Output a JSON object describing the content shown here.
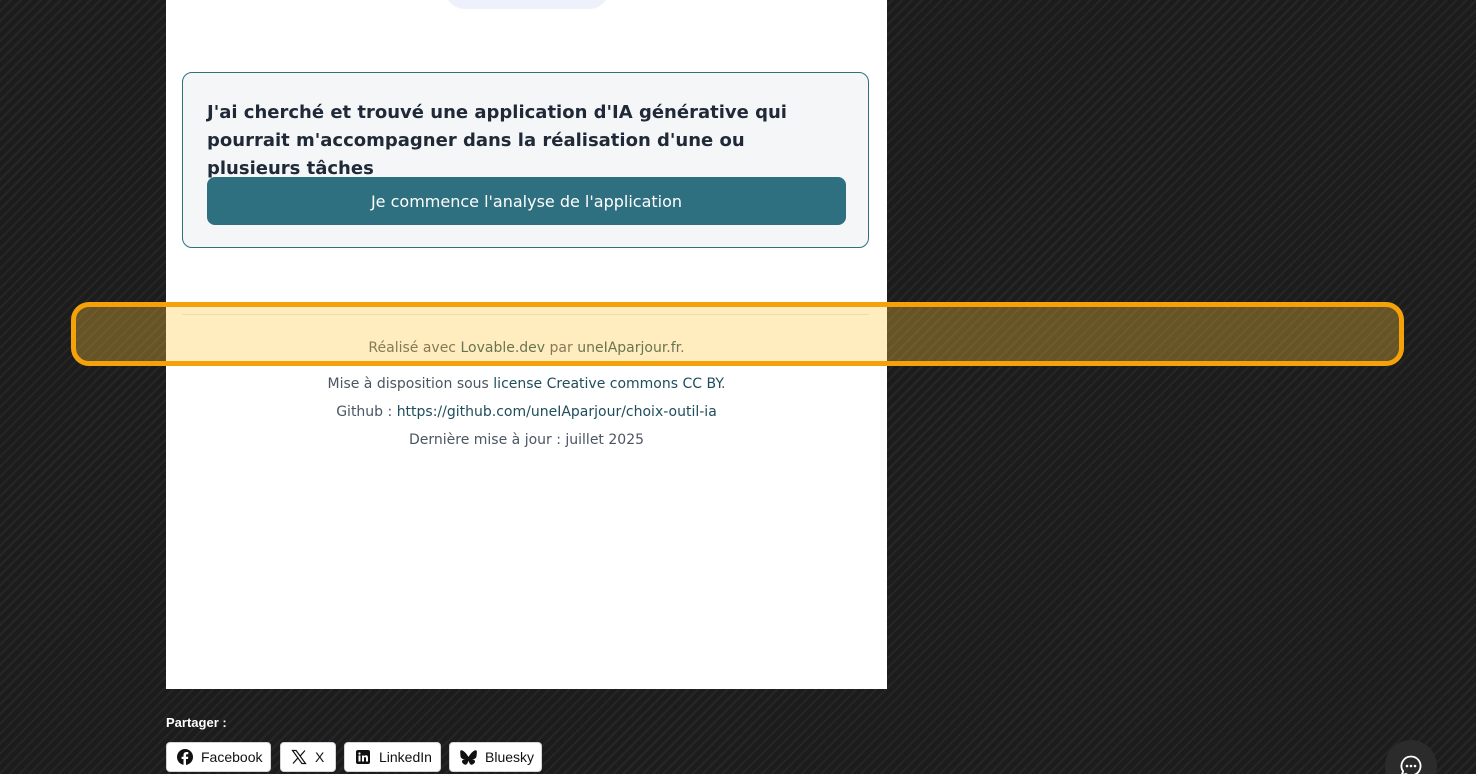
{
  "card": {
    "text": "J'ai cherché et trouvé une application d'IA générative qui pourrait m'accompagner dans la réalisation d'une ou plusieurs tâches",
    "button_label": "Je commence l'analyse de l'application"
  },
  "footer": {
    "made_with_prefix": "Réalisé avec ",
    "lovable_link": "Lovable.dev",
    "by_text": " par ",
    "site_link": "uneIAparjour.fr",
    "made_with_suffix": ".",
    "license_prefix": "Mise à disposition sous ",
    "license_link": "license Creative commons CC BY",
    "license_suffix": ".",
    "github_prefix": "Github : ",
    "github_link": "https://github.com/uneIAparjour/choix-outil-ia",
    "last_update": "Dernière mise à jour : juillet 2025"
  },
  "share": {
    "label": "Partager :",
    "buttons": [
      {
        "label": "Facebook",
        "icon": "facebook-icon"
      },
      {
        "label": "X",
        "icon": "x-icon"
      },
      {
        "label": "LinkedIn",
        "icon": "linkedin-icon"
      },
      {
        "label": "Bluesky",
        "icon": "bluesky-icon"
      }
    ]
  },
  "chat": {
    "icon": "chat-ellipsis-icon"
  },
  "colors": {
    "accent": "#2e6f80",
    "highlight": "#f5a10a",
    "link": "#1e4d5c"
  }
}
